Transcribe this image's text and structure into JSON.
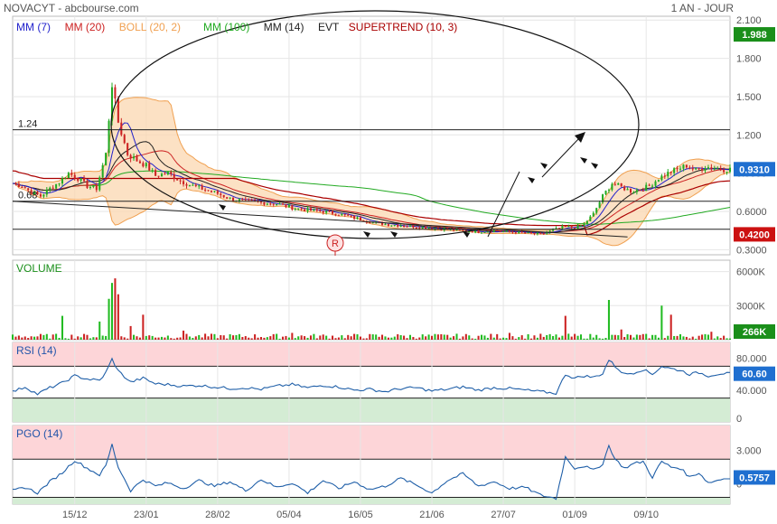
{
  "header": {
    "title": "NOVACYT - abcbourse.com",
    "period": "1 AN - JOUR"
  },
  "colors": {
    "ma7": "#2222cc",
    "ma20": "#cc2222",
    "boll": "#f0a050",
    "boll_fill": "#fbd7b0",
    "ma100": "#22aa22",
    "ma14": "#222222",
    "supertrend": "#aa0000",
    "candle_up": "#22aa22",
    "candle_down": "#cc2222",
    "volume_up": "#22bb22",
    "volume_down": "#cc2222",
    "rsi_line": "#1f5fa8",
    "overbought": "#fdd5d8",
    "oversold": "#d4ecd4",
    "badge_green": "#1a8f1a",
    "badge_red": "#cc1111",
    "badge_blue": "#1f6fd0",
    "grid": "#e6e6e6"
  },
  "chart_data": [
    {
      "type": "candlestick",
      "panel": "price",
      "legend": [
        {
          "label": "MM (7)",
          "color": "#2222cc"
        },
        {
          "label": "MM (20)",
          "color": "#cc2222"
        },
        {
          "label": "BOLL (20, 2)",
          "color": "#f0a050"
        },
        {
          "label": "MM (100)",
          "color": "#22aa22"
        },
        {
          "label": "MM (14)",
          "color": "#222222"
        },
        {
          "label": "EVT",
          "color": "#222222"
        },
        {
          "label": "SUPERTREND (10, 3)",
          "color": "#aa0000"
        }
      ],
      "y_ticks": [
        "2.100",
        "1.800",
        "1.500",
        "1.200",
        "0.9000",
        "0.6000",
        "0.3000"
      ],
      "ylim": [
        0.26,
        2.13
      ],
      "x_ticks": [
        "15/12",
        "23/01",
        "28/02",
        "05/04",
        "16/05",
        "21/06",
        "27/07",
        "01/09",
        "09/10"
      ],
      "hline_labels": [
        "1.24",
        "0.68"
      ],
      "marker_label": "R",
      "badges": [
        {
          "text": "1.988",
          "kind": "green"
        },
        {
          "text": "0.9310",
          "kind": "blue"
        },
        {
          "text": "0.4200",
          "kind": "red"
        }
      ],
      "close_points": [
        [
          0,
          0.82
        ],
        [
          3,
          0.8
        ],
        [
          6,
          0.75
        ],
        [
          9,
          0.72
        ],
        [
          12,
          0.78
        ],
        [
          15,
          0.83
        ],
        [
          18,
          0.9
        ],
        [
          21,
          0.86
        ],
        [
          24,
          0.8
        ],
        [
          27,
          0.78
        ],
        [
          30,
          1.05
        ],
        [
          32,
          1.6
        ],
        [
          34,
          1.3
        ],
        [
          37,
          1.05
        ],
        [
          40,
          1.0
        ],
        [
          43,
          0.96
        ],
        [
          46,
          0.88
        ],
        [
          50,
          0.9
        ],
        [
          54,
          0.84
        ],
        [
          58,
          0.8
        ],
        [
          62,
          0.77
        ],
        [
          66,
          0.74
        ],
        [
          70,
          0.7
        ],
        [
          75,
          0.68
        ],
        [
          80,
          0.67
        ],
        [
          85,
          0.66
        ],
        [
          90,
          0.63
        ],
        [
          95,
          0.61
        ],
        [
          100,
          0.6
        ],
        [
          105,
          0.58
        ],
        [
          110,
          0.55
        ],
        [
          115,
          0.52
        ],
        [
          120,
          0.5
        ],
        [
          125,
          0.49
        ],
        [
          130,
          0.48
        ],
        [
          135,
          0.47
        ],
        [
          140,
          0.46
        ],
        [
          145,
          0.45
        ],
        [
          150,
          0.44
        ],
        [
          155,
          0.45
        ],
        [
          160,
          0.44
        ],
        [
          165,
          0.43
        ],
        [
          170,
          0.42
        ],
        [
          175,
          0.46
        ],
        [
          178,
          0.48
        ],
        [
          181,
          0.47
        ],
        [
          184,
          0.5
        ],
        [
          187,
          0.58
        ],
        [
          190,
          0.72
        ],
        [
          193,
          0.82
        ],
        [
          196,
          0.79
        ],
        [
          199,
          0.76
        ],
        [
          202,
          0.77
        ],
        [
          205,
          0.8
        ],
        [
          208,
          0.86
        ],
        [
          211,
          0.9
        ],
        [
          214,
          0.93
        ],
        [
          217,
          0.96
        ],
        [
          220,
          0.92
        ],
        [
          223,
          0.95
        ],
        [
          226,
          0.94
        ],
        [
          229,
          0.93
        ],
        [
          231,
          0.931
        ]
      ]
    },
    {
      "type": "bar",
      "panel": "volume",
      "title": "VOLUME",
      "y_ticks": [
        "6000K",
        "3000K"
      ],
      "ylim": [
        0,
        7000
      ],
      "last_value": "266K",
      "spikes": [
        [
          16,
          2100
        ],
        [
          28,
          1600
        ],
        [
          31,
          3600
        ],
        [
          32,
          5000
        ],
        [
          33,
          5400
        ],
        [
          34,
          4000
        ],
        [
          38,
          1200
        ],
        [
          42,
          2200
        ],
        [
          55,
          800
        ],
        [
          90,
          600
        ],
        [
          125,
          400
        ],
        [
          160,
          600
        ],
        [
          178,
          2100
        ],
        [
          192,
          3500
        ],
        [
          196,
          900
        ],
        [
          209,
          3000
        ],
        [
          212,
          2200
        ],
        [
          225,
          700
        ]
      ]
    },
    {
      "type": "line",
      "panel": "rsi",
      "title": "RSI (14)",
      "y_ticks": [
        "80.000",
        "40.000",
        "0"
      ],
      "ylim": [
        0,
        100
      ],
      "overbought": 70,
      "oversold": 30,
      "last_value": "60.60",
      "points": [
        [
          0,
          38
        ],
        [
          4,
          44
        ],
        [
          8,
          35
        ],
        [
          12,
          43
        ],
        [
          16,
          49
        ],
        [
          20,
          58
        ],
        [
          24,
          54
        ],
        [
          28,
          52
        ],
        [
          30,
          62
        ],
        [
          32,
          79
        ],
        [
          34,
          64
        ],
        [
          38,
          50
        ],
        [
          42,
          55
        ],
        [
          46,
          48
        ],
        [
          50,
          47
        ],
        [
          55,
          45
        ],
        [
          60,
          46
        ],
        [
          65,
          44
        ],
        [
          70,
          42
        ],
        [
          75,
          43
        ],
        [
          80,
          41
        ],
        [
          85,
          45
        ],
        [
          90,
          47
        ],
        [
          95,
          43
        ],
        [
          100,
          46
        ],
        [
          105,
          44
        ],
        [
          110,
          40
        ],
        [
          115,
          41
        ],
        [
          120,
          38
        ],
        [
          125,
          42
        ],
        [
          130,
          43
        ],
        [
          135,
          39
        ],
        [
          140,
          41
        ],
        [
          145,
          44
        ],
        [
          150,
          40
        ],
        [
          155,
          43
        ],
        [
          160,
          42
        ],
        [
          165,
          40
        ],
        [
          170,
          38
        ],
        [
          175,
          36
        ],
        [
          178,
          60
        ],
        [
          181,
          55
        ],
        [
          184,
          58
        ],
        [
          187,
          56
        ],
        [
          190,
          61
        ],
        [
          192,
          78
        ],
        [
          194,
          70
        ],
        [
          197,
          60
        ],
        [
          200,
          62
        ],
        [
          203,
          66
        ],
        [
          206,
          60
        ],
        [
          209,
          70
        ],
        [
          212,
          67
        ],
        [
          215,
          65
        ],
        [
          218,
          60
        ],
        [
          221,
          62
        ],
        [
          224,
          58
        ],
        [
          228,
          61
        ],
        [
          231,
          60.6
        ]
      ]
    },
    {
      "type": "line",
      "panel": "pgo",
      "title": "PGO (14)",
      "y_ticks": [
        "3.000",
        "0"
      ],
      "ylim": [
        -1.8,
        5.2
      ],
      "overbought": 2.2,
      "oversold": -1.2,
      "last_value": "0.5757",
      "points": [
        [
          0,
          -0.6
        ],
        [
          4,
          -0.3
        ],
        [
          8,
          -0.8
        ],
        [
          12,
          0.2
        ],
        [
          16,
          1.0
        ],
        [
          20,
          2.1
        ],
        [
          24,
          1.4
        ],
        [
          28,
          0.8
        ],
        [
          30,
          1.6
        ],
        [
          32,
          3.5
        ],
        [
          34,
          1.5
        ],
        [
          38,
          -0.6
        ],
        [
          42,
          0.4
        ],
        [
          46,
          -0.2
        ],
        [
          50,
          0.1
        ],
        [
          55,
          -0.4
        ],
        [
          60,
          0.3
        ],
        [
          65,
          -0.2
        ],
        [
          70,
          0.2
        ],
        [
          75,
          -0.6
        ],
        [
          80,
          0.4
        ],
        [
          85,
          -0.3
        ],
        [
          90,
          0.1
        ],
        [
          95,
          -0.8
        ],
        [
          100,
          0.3
        ],
        [
          105,
          -0.4
        ],
        [
          110,
          0.2
        ],
        [
          115,
          -0.5
        ],
        [
          120,
          -0.2
        ],
        [
          125,
          0.5
        ],
        [
          130,
          -0.1
        ],
        [
          135,
          -0.8
        ],
        [
          140,
          0.3
        ],
        [
          145,
          0.9
        ],
        [
          150,
          -0.2
        ],
        [
          155,
          0.2
        ],
        [
          160,
          -0.4
        ],
        [
          165,
          -0.3
        ],
        [
          170,
          -1.0
        ],
        [
          175,
          -1.3
        ],
        [
          178,
          2.4
        ],
        [
          181,
          1.4
        ],
        [
          184,
          1.6
        ],
        [
          187,
          1.2
        ],
        [
          190,
          1.8
        ],
        [
          192,
          3.4
        ],
        [
          194,
          2.2
        ],
        [
          197,
          1.4
        ],
        [
          200,
          1.8
        ],
        [
          203,
          2.0
        ],
        [
          206,
          0.6
        ],
        [
          209,
          2.0
        ],
        [
          212,
          1.5
        ],
        [
          215,
          1.4
        ],
        [
          218,
          0.6
        ],
        [
          221,
          1.0
        ],
        [
          224,
          0.1
        ],
        [
          228,
          0.4
        ],
        [
          231,
          0.5757
        ]
      ]
    }
  ]
}
